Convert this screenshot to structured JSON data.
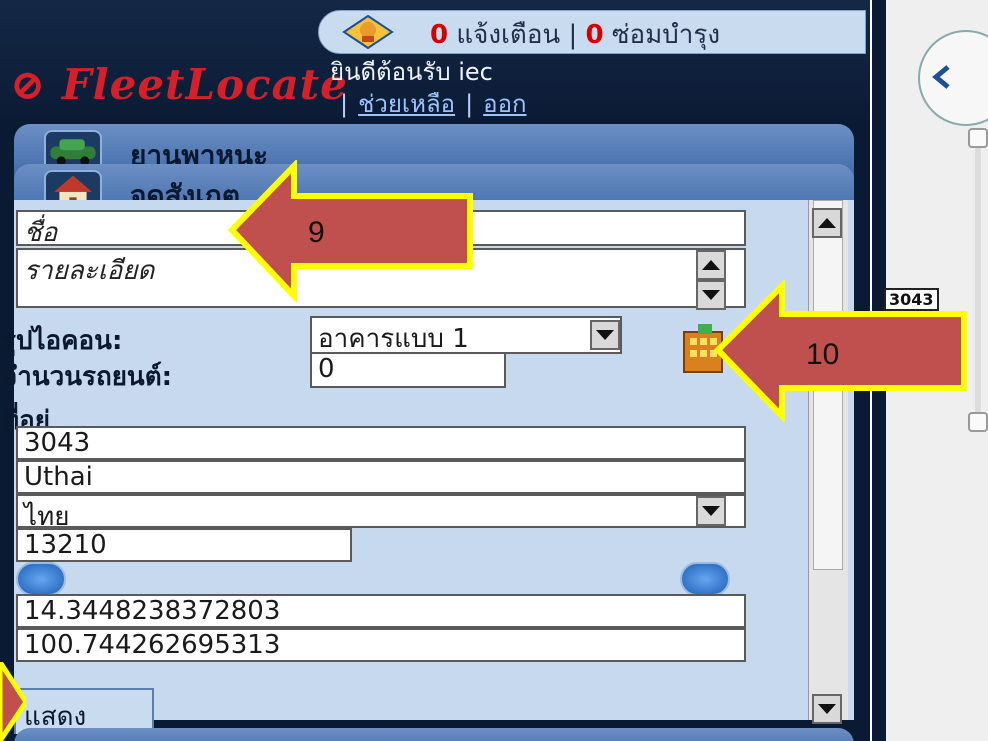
{
  "header": {
    "alert_count": "0",
    "alert_label": "แจ้งเตือน",
    "separator": "|",
    "maint_count": "0",
    "maint_label": "ซ่อมบำรุง",
    "logo": "FleetLocate",
    "welcome": "ยินดีต้อนรับ iec",
    "help_link": "ช่วยเหลือ",
    "logout_link": "ออก"
  },
  "sections": {
    "vehicles": "ยานพาหนะ",
    "landmarks": "จุดสังเกต"
  },
  "form": {
    "name_placeholder": "ชื่อ",
    "detail_placeholder": "รายละเอียด",
    "icon_label": "รูปไอคอน:",
    "icon_value": "อาคารแบบ 1",
    "vehicle_count_label": "จำนวนรถยนต์:",
    "vehicle_count_value": "0",
    "address_label": "ที่อยู่",
    "address_line": "3043",
    "city": "Uthai",
    "country": "ไทย",
    "postal": "13210",
    "latitude": "14.3448238372803",
    "longitude": "100.744262695313",
    "show_tab": "แสดง"
  },
  "annotations": {
    "arrow_9": "9",
    "arrow_10": "10"
  },
  "map": {
    "marker_label": "3043"
  },
  "icons": {
    "alert": "bell-icon",
    "vehicle": "car-icon",
    "landmark": "house-icon",
    "building": "building-icon",
    "geocode": "refresh-left-icon",
    "reverse": "refresh-right-icon"
  }
}
